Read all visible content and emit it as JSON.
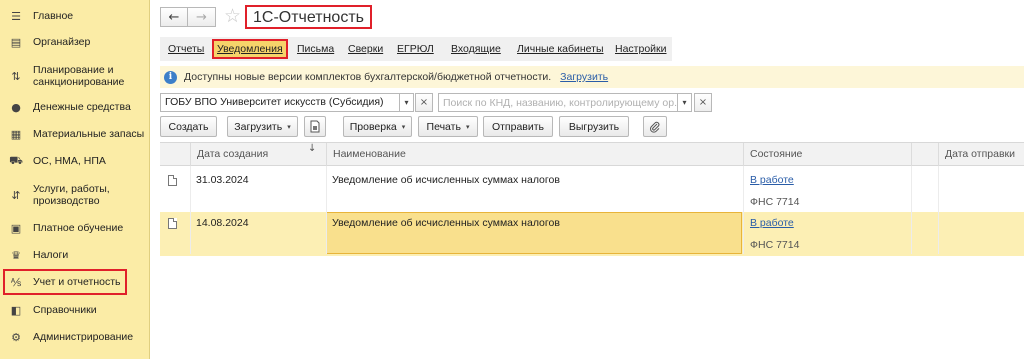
{
  "sidebar": {
    "items": [
      {
        "label": "Главное",
        "icon": "hamburger-menu-icon",
        "glyph": "☰"
      },
      {
        "label": "Органайзер",
        "icon": "organizer-icon",
        "glyph": "▤"
      },
      {
        "label": "Планирование и санкционирование",
        "icon": "planning-icon",
        "glyph": "⇅"
      },
      {
        "label": "Денежные средства",
        "icon": "money-coin-icon",
        "glyph": "●"
      },
      {
        "label": "Материальные запасы",
        "icon": "inventory-icon",
        "glyph": "▦"
      },
      {
        "label": "ОС, НМА, НПА",
        "icon": "assets-truck-icon",
        "glyph": "⛟"
      },
      {
        "label": "Услуги, работы, производство",
        "icon": "services-icon",
        "glyph": "⇵"
      },
      {
        "label": "Платное обучение",
        "icon": "education-icon",
        "glyph": "▣"
      },
      {
        "label": "Налоги",
        "icon": "taxes-icon",
        "glyph": "♛"
      },
      {
        "label": "Учет и отчетность",
        "icon": "accounting-icon",
        "glyph": "⅍"
      },
      {
        "label": "Справочники",
        "icon": "reference-books-icon",
        "glyph": "◧"
      },
      {
        "label": "Администрирование",
        "icon": "admin-gear-icon",
        "glyph": "⚙"
      }
    ]
  },
  "header": {
    "back_icon": "←",
    "forward_icon": "→",
    "favorite_icon": "☆",
    "title": "1С-Отчетность"
  },
  "tabs": [
    {
      "label": "Отчеты"
    },
    {
      "label": "Уведомления"
    },
    {
      "label": "Письма"
    },
    {
      "label": "Сверки"
    },
    {
      "label": "ЕГРЮЛ"
    },
    {
      "label": "Входящие"
    },
    {
      "label": "Личные кабинеты"
    },
    {
      "label": "Настройки"
    }
  ],
  "infobar": {
    "icon": "i",
    "text": "Доступны новые версии комплектов бухгалтерской/бюджетной отчетности.",
    "link": "Загрузить"
  },
  "filters": {
    "organization": "ГОБУ ВПО Университет искусств (Субсидия)",
    "search_placeholder": "Поиск по КНД, названию, контролирующему ор...",
    "dropdown_icon": "▾",
    "clear_icon": "×"
  },
  "toolbar": {
    "create": "Создать",
    "load": "Загрузить",
    "check": "Проверка",
    "print": "Печать",
    "send": "Отправить",
    "export": "Выгрузить",
    "caret": "▾",
    "attach_icon": "📎"
  },
  "table": {
    "columns": {
      "date": "Дата создания",
      "name": "Наименование",
      "state": "Состояние",
      "sent": "Дата отправки"
    },
    "sort_icon": "↓",
    "rows": [
      {
        "date": "31.03.2024",
        "name": "Уведомление об исчисленных суммах налогов",
        "status": "В работе",
        "authority": "ФНС 7714",
        "selected": false
      },
      {
        "date": "14.08.2024",
        "name": "Уведомление об исчисленных суммах налогов",
        "status": "В работе",
        "authority": "ФНС 7714",
        "selected": true
      }
    ]
  }
}
